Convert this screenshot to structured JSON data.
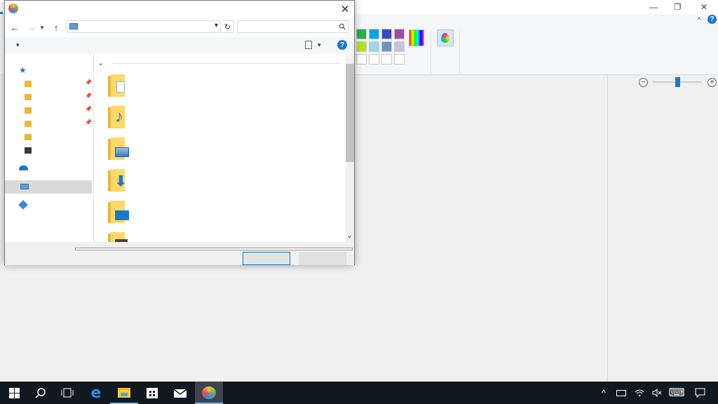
{
  "paint": {
    "window_buttons": {
      "minimize": "—",
      "restore": "❐",
      "close": "✕",
      "collapse": "^",
      "help": "?"
    },
    "palette_colors": [
      "#22b14c",
      "#00a2e8",
      "#3f48cc",
      "#a349a4",
      "#b5e61d",
      "#99d9ea",
      "#7092be",
      "#c8bfe7",
      "#ffffff",
      "#ffffff",
      "#ffffff",
      "#ffffff"
    ],
    "zoom": {
      "minus": "−",
      "plus": "+",
      "level": 0.5
    }
  },
  "dialog": {
    "close_icon": "✕",
    "nav": {
      "back": "←",
      "forward": "→",
      "recent": "▾",
      "up": "↑",
      "refresh": "↻",
      "search_icon": "⚲"
    },
    "toolbar": {
      "organize_dropdown": "▾",
      "view_dropdown": "▾",
      "help": "?"
    },
    "section_chevron": "⌄",
    "scroll_down": "⌄",
    "accent_color": "#0078d7"
  },
  "taskbar": {
    "start_icon": "windows",
    "tray": {
      "chevron": "^",
      "keyboard": "⌨",
      "notification": "🗨"
    }
  }
}
